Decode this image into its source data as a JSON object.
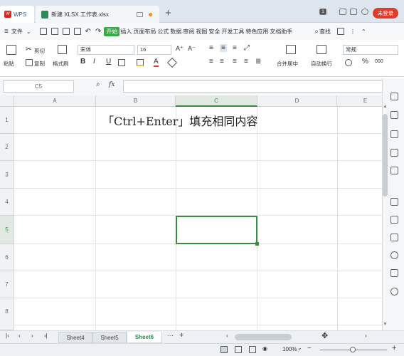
{
  "app": {
    "wps_label": "WPS",
    "login_label": "未登录"
  },
  "tabs": {
    "doc_title": "新建 XLSX 工作表.xlsx",
    "add_tab": "+"
  },
  "menu": {
    "file": "文件",
    "items": [
      "开始",
      "插入",
      "页面布局",
      "公式",
      "数据",
      "审阅",
      "视图",
      "安全",
      "开发工具",
      "特色应用",
      "文档助手"
    ],
    "search": "查找"
  },
  "ribbon": {
    "cut": "剪切",
    "paste": "粘贴",
    "copy": "复制",
    "format_painter": "格式刷",
    "font_name": "宋体",
    "font_size": "16",
    "merge_center": "合并居中",
    "wrap_text": "自动换行",
    "number_format": "常规",
    "bold": "B",
    "italic": "I",
    "underline": "U",
    "font_grow": "A⁺",
    "font_shrink": "A⁻",
    "percent": "%",
    "thousands": "000"
  },
  "formula_bar": {
    "cell_ref": "C5",
    "fx_label": "fx",
    "value": ""
  },
  "columns": [
    "A",
    "B",
    "C",
    "D",
    "E"
  ],
  "rows": [
    "1",
    "2",
    "3",
    "4",
    "5",
    "6",
    "7",
    "8"
  ],
  "cells": {
    "B1": "「Ctrl+Enter」填充相同内容"
  },
  "selected_cell": "C5",
  "sheets": [
    "Sheet4",
    "Sheet5",
    "Sheet6"
  ],
  "active_sheet": "Sheet6",
  "status": {
    "zoom": "100%",
    "zoom_minus": "−",
    "zoom_plus": "+"
  },
  "colors": {
    "accent_green": "#3b8a3e",
    "login_red": "#e03b2b",
    "title_bg": "#dde6ef"
  }
}
